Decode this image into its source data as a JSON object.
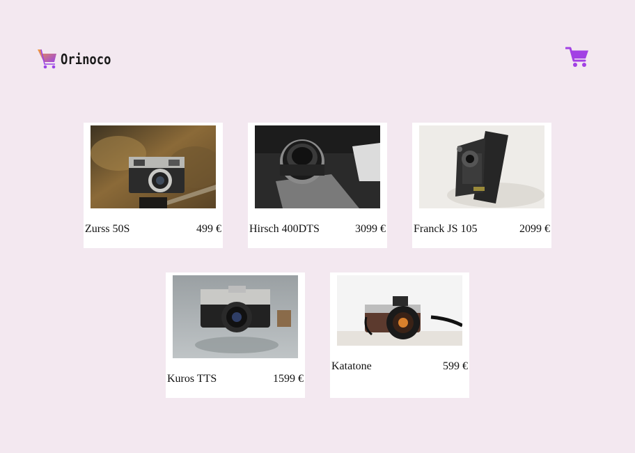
{
  "header": {
    "brand": "Orinoco",
    "logo_icon": "shopping-cart-icon",
    "cart_icon": "shopping-cart-icon"
  },
  "colors": {
    "background": "#f3e8f0",
    "accent": "#a241e4",
    "logo_gradient_start": "#f29a3b",
    "logo_gradient_end": "#9a44e6"
  },
  "products": [
    {
      "name": "Zurss 50S",
      "price": "499 €"
    },
    {
      "name": "Hirsch 400DTS",
      "price": "3099 €"
    },
    {
      "name": "Franck JS 105",
      "price": "2099 €"
    },
    {
      "name": "Kuros TTS",
      "price": "1599 €"
    },
    {
      "name": "Katatone",
      "price": "599 €"
    }
  ]
}
